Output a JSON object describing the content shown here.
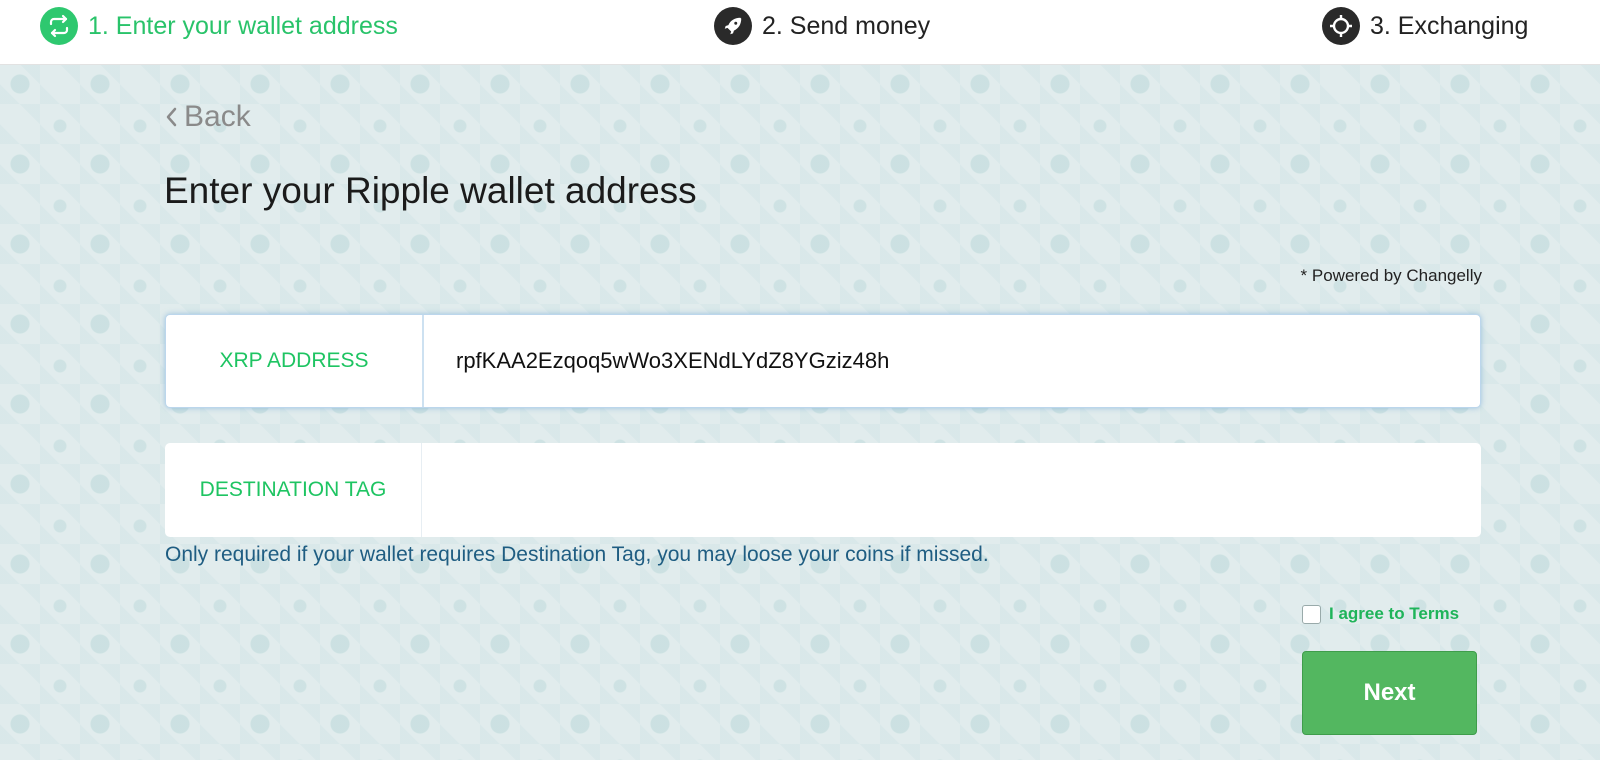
{
  "steps": [
    {
      "label": "1. Enter your wallet address",
      "icon": "exchange-cycle-icon",
      "active": true
    },
    {
      "label": "2. Send money",
      "icon": "rocket-icon",
      "active": false
    },
    {
      "label": "3. Exchanging",
      "icon": "target-icon",
      "active": false
    }
  ],
  "back_label": "Back",
  "title": "Enter your Ripple wallet address",
  "powered_by": "* Powered by Changelly",
  "xrp_field": {
    "label": "XRP ADDRESS",
    "value": "rpfKAA2Ezqoq5wWo3XENdLYdZ8YGziz48h"
  },
  "tag_field": {
    "label": "DESTINATION TAG",
    "value": ""
  },
  "hint": "Only required if your wallet requires Destination Tag, you may loose your coins if missed.",
  "terms_label": "I agree to Terms",
  "next_label": "Next",
  "colors": {
    "accent": "#2ec86f",
    "button": "#53b760",
    "hint": "#1f5d82"
  }
}
